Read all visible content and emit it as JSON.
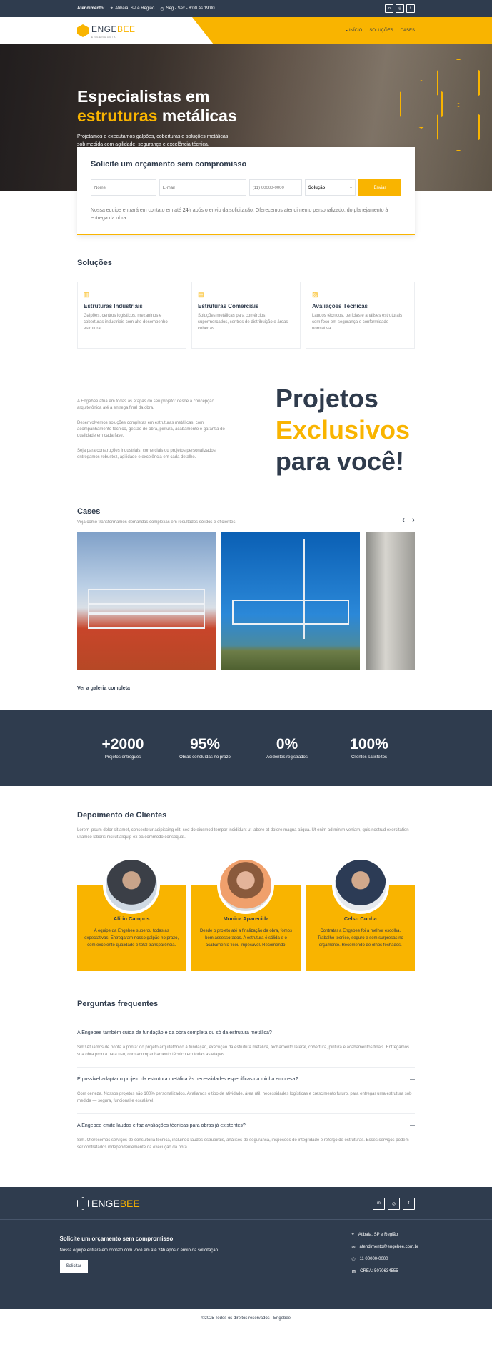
{
  "topbar": {
    "label": "Atendimento:",
    "location": "Atibaia, SP e Região",
    "hours": "Seg - Sex - 8:00 às 19:00",
    "social": [
      "in",
      "◎",
      "f"
    ]
  },
  "brand": {
    "name_a": "ENGE",
    "name_b": "BEE",
    "sub": "ENGENHARIA"
  },
  "nav": {
    "items": [
      "INÍCIO",
      "SOLUÇÕES",
      "CASES"
    ]
  },
  "hero": {
    "title_line1": "Especialistas em",
    "title_hl": "estruturas",
    "title_rest": " metálicas",
    "text": "Projetamos e executamos galpões, coberturas e soluções metálicas sob medida com agilidade, segurança e excelência técnica."
  },
  "quote": {
    "title": "Solicite um orçamento sem compromisso",
    "name_ph": "Nome",
    "email_ph": "E-mail",
    "phone_ph": "(11) 00000-0000",
    "select": "Solução",
    "submit": "Enviar",
    "note_a": "Nossa equipe entrará em contato em até ",
    "note_b": "24h",
    "note_c": " após o envio da solicitação. Oferecemos atendimento personalizado, do planejamento à entrega da obra."
  },
  "solutions": {
    "title": "Soluções",
    "cards": [
      {
        "title": "Estruturas Industriais",
        "text": "Galpões, centros logísticos, mezaninos e coberturas industriais com alto desempenho estrutural."
      },
      {
        "title": "Estruturas Comerciais",
        "text": "Soluções metálicas para comércios, supermercados, centros de distribuição e áreas cobertas."
      },
      {
        "title": "Avaliações Técnicas",
        "text": "Laudos técnicos, perícias e análises estruturais com foco em segurança e conformidade normativa."
      }
    ]
  },
  "about": {
    "p1": "A Engebee atua em todas as etapas do seu projeto: desde a concepção arquitetônica até a entrega final da obra.",
    "p2": "Desenvolvemos soluções completas em estruturas metálicas, com acompanhamento técnico, gestão de obra, pintura, acabamento e garantia de qualidade em cada fase.",
    "p3": "Seja para construções industriais, comerciais ou projetos personalizados, entregamos robustez, agilidade e excelência em cada detalhe.",
    "big1": "Projetos",
    "big2": "Exclusivos",
    "big3": "para você!"
  },
  "cases": {
    "title": "Cases",
    "subtitle": "Veja como transformamos demandas complexas em resultados sólidos e eficientes.",
    "link": "Ver a galeria completa"
  },
  "stats": [
    {
      "num": "+2000",
      "label": "Projetos entregues"
    },
    {
      "num": "95%",
      "label": "Obras concluídas no prazo"
    },
    {
      "num": "0%",
      "label": "Acidentes registrados"
    },
    {
      "num": "100%",
      "label": "Clientes satisfeitos"
    }
  ],
  "testimonials": {
    "title": "Depoimento de Clientes",
    "intro": "Lorem ipsum dolor sit amet, consectetur adipiscing elit, sed do eiusmod tempor incididunt ut labore et dolore magna aliqua. Ut enim ad minim veniam, quis nostrud exercitation ullamco laboris nisi ut aliquip ex ea commodo consequat.",
    "items": [
      {
        "name": "Alírio Campos",
        "text": "A equipe da Engebee superou todas as expectativas. Entregaram nosso galpão no prazo, com excelente qualidade e total transparência."
      },
      {
        "name": "Monica Aparecida",
        "text": "Desde o projeto até a finalização da obra, fomos bem assessorados. A estrutura é sólida e o acabamento ficou impecável. Recomendo!"
      },
      {
        "name": "Celso Cunha",
        "text": "Contratar a Engebee foi a melhor escolha. Trabalho técnico, seguro e sem surpresas no orçamento. Recomendo de olhos fechados."
      }
    ]
  },
  "faq": {
    "title": "Perguntas frequentes",
    "items": [
      {
        "q": "A Engebee também cuida da fundação e da obra completa ou só da estrutura metálica?",
        "a": "Sim! Atuamos de ponta a ponta: do projeto arquitetônico à fundação, execução da estrutura metálica, fechamento lateral, cobertura, pintura e acabamentos finais. Entregamos sua obra pronta para uso, com acompanhamento técnico em todas as etapas."
      },
      {
        "q": "É possível adaptar o projeto da estrutura metálica às necessidades específicas da minha empresa?",
        "a": "Com certeza. Nossos projetos são 100% personalizados. Avaliamos o tipo de atividade, área útil, necessidades logísticas e crescimento futuro, para entregar uma estrutura sob medida — segura, funcional e escalável."
      },
      {
        "q": "A Engebee emite laudos e faz avaliações técnicas para obras já existentes?",
        "a": "Sim. Oferecemos serviços de consultoria técnica, incluindo laudos estruturais, análises de segurança, inspeções de integridade e reforço de estruturas. Esses serviços podem ser contratados independentemente da execução da obra."
      }
    ]
  },
  "footer": {
    "cta_title": "Solicite um orçamento sem compromisso",
    "cta_text": "Nossa equipe entrará em contato com você em até 24h após o envio da solicitação.",
    "cta_button": "Solicitar",
    "location": "Atibaia, SP e Região",
    "email": "atendimento@engebee.com.br",
    "phone": "11 00000-0000",
    "crea": "CREA: 5070634555",
    "copyright": "©2025 Todos os direitos reservados - Engebee"
  }
}
